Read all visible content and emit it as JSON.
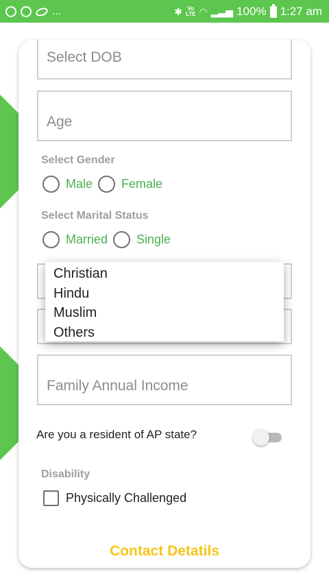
{
  "status_bar": {
    "left_icons": [
      "circle-arrow-icon",
      "circle-icon",
      "oval-icon"
    ],
    "ellipsis": "...",
    "network_label": "Vo)\nLTE",
    "battery": "100%",
    "time": "1:27 am"
  },
  "form": {
    "dob_placeholder": "Select DOB",
    "age_placeholder": "Age",
    "gender": {
      "label": "Select Gender",
      "options": [
        "Male",
        "Female"
      ]
    },
    "marital": {
      "label": "Select Marital Status",
      "options": [
        "Married",
        "Single"
      ]
    },
    "religion_dropdown": {
      "options": [
        "Christian",
        "Hindu",
        "Muslim",
        "Others"
      ]
    },
    "income_placeholder": "Family Annual Income",
    "resident_question": "Are you a resident of AP state?",
    "resident_toggle_on": false,
    "disability": {
      "label": "Disability",
      "option": "Physically Challenged",
      "checked": false
    },
    "next_section": "Contact Detatils"
  },
  "colors": {
    "accent_green": "#5cc64f",
    "option_green": "#4caf50",
    "heading_yellow": "#f5c518"
  }
}
